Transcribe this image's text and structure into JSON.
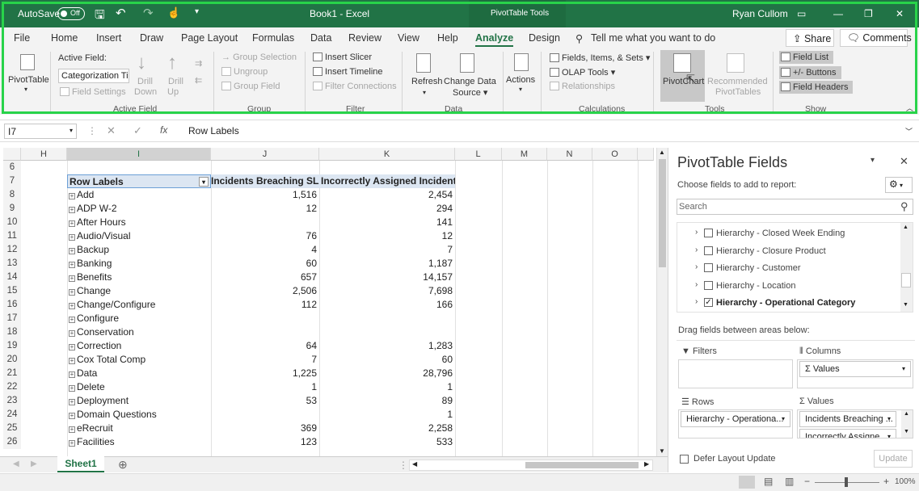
{
  "titlebar": {
    "autosave_label": "AutoSave",
    "autosave_state": "Off",
    "doc_title": "Book1 - Excel",
    "tools_context": "PivotTable Tools",
    "user": "Ryan Cullom",
    "accent": "#217346"
  },
  "tabs": {
    "items": [
      "File",
      "Home",
      "Insert",
      "Draw",
      "Page Layout",
      "Formulas",
      "Data",
      "Review",
      "View",
      "Help",
      "Analyze",
      "Design"
    ],
    "active": "Analyze",
    "tell_me": "Tell me what you want to do",
    "share": "Share",
    "comments": "Comments"
  },
  "ribbon": {
    "pivottable": "PivotTable",
    "active_field_label": "Active Field:",
    "active_field_value": "Categorization Tie",
    "field_settings": "Field Settings",
    "drill_down_1": "Drill",
    "drill_down_2": "Down",
    "drill_up_1": "Drill",
    "drill_up_2": "Up",
    "group_selection": "Group Selection",
    "ungroup": "Ungroup",
    "group_field": "Group Field",
    "insert_slicer": "Insert Slicer",
    "insert_timeline": "Insert Timeline",
    "filter_connections": "Filter Connections",
    "refresh": "Refresh",
    "change_data_1": "Change Data",
    "change_data_2": "Source",
    "actions": "Actions",
    "fields_items_sets": "Fields, Items, & Sets",
    "olap_tools": "OLAP Tools",
    "relationships": "Relationships",
    "pivotchart": "PivotChart",
    "recommended_1": "Recommended",
    "recommended_2": "PivotTables",
    "field_list": "Field List",
    "buttons": "+/- Buttons",
    "field_headers": "Field Headers",
    "groups": {
      "active_field": "Active Field",
      "group": "Group",
      "filter": "Filter",
      "data": "Data",
      "calculations": "Calculations",
      "tools": "Tools",
      "show": "Show"
    }
  },
  "formula": {
    "name_box": "I7",
    "fx": "fx",
    "content": "Row Labels"
  },
  "grid": {
    "columns": [
      "H",
      "I",
      "J",
      "K",
      "L",
      "M",
      "N",
      "O"
    ],
    "rows": [
      {
        "n": "6",
        "label": "",
        "j": "",
        "k": ""
      },
      {
        "n": "7",
        "label": "Row Labels",
        "j": "Incidents Breaching SLA",
        "k": "Incorrectly Assigned Incidents"
      },
      {
        "n": "8",
        "label": "Add",
        "j": "1,516",
        "k": "2,454"
      },
      {
        "n": "9",
        "label": "ADP W-2",
        "j": "12",
        "k": "294"
      },
      {
        "n": "10",
        "label": "After Hours",
        "j": "",
        "k": "141"
      },
      {
        "n": "11",
        "label": "Audio/Visual",
        "j": "76",
        "k": "12"
      },
      {
        "n": "12",
        "label": "Backup",
        "j": "4",
        "k": "7"
      },
      {
        "n": "13",
        "label": "Banking",
        "j": "60",
        "k": "1,187"
      },
      {
        "n": "14",
        "label": "Benefits",
        "j": "657",
        "k": "14,157"
      },
      {
        "n": "15",
        "label": "Change",
        "j": "2,506",
        "k": "7,698"
      },
      {
        "n": "16",
        "label": "Change/Configure",
        "j": "112",
        "k": "166"
      },
      {
        "n": "17",
        "label": "Configure",
        "j": "",
        "k": ""
      },
      {
        "n": "18",
        "label": "Conservation",
        "j": "",
        "k": ""
      },
      {
        "n": "19",
        "label": "Correction",
        "j": "64",
        "k": "1,283"
      },
      {
        "n": "20",
        "label": "Cox Total Comp",
        "j": "7",
        "k": "60"
      },
      {
        "n": "21",
        "label": "Data",
        "j": "1,225",
        "k": "28,796"
      },
      {
        "n": "22",
        "label": "Delete",
        "j": "1",
        "k": "1"
      },
      {
        "n": "23",
        "label": "Deployment",
        "j": "53",
        "k": "89"
      },
      {
        "n": "24",
        "label": "Domain Questions",
        "j": "",
        "k": "1"
      },
      {
        "n": "25",
        "label": "eRecruit",
        "j": "369",
        "k": "2,258"
      },
      {
        "n": "26",
        "label": "Facilities",
        "j": "123",
        "k": "533"
      }
    ]
  },
  "sheet": {
    "tab": "Sheet1"
  },
  "status": {
    "zoom": "100%"
  },
  "panel": {
    "title": "PivotTable Fields",
    "subtitle": "Choose fields to add to report:",
    "search_placeholder": "Search",
    "fields": [
      {
        "label": "Hierarchy - Closed Week Ending",
        "checked": false
      },
      {
        "label": "Hierarchy - Closure Product",
        "checked": false
      },
      {
        "label": "Hierarchy - Customer",
        "checked": false
      },
      {
        "label": "Hierarchy - Location",
        "checked": false
      },
      {
        "label": "Hierarchy - Operational Category",
        "checked": true
      }
    ],
    "drag_label": "Drag fields between areas below:",
    "filters": "Filters",
    "columns": "Columns",
    "rows": "Rows",
    "values": "Values",
    "columns_chip": "Values",
    "rows_chip": "Hierarchy - Operationa...",
    "values_chip_1": "Incidents Breaching ...",
    "values_chip_2": "Incorrectly Assigne...",
    "defer": "Defer Layout Update",
    "update": "Update"
  }
}
